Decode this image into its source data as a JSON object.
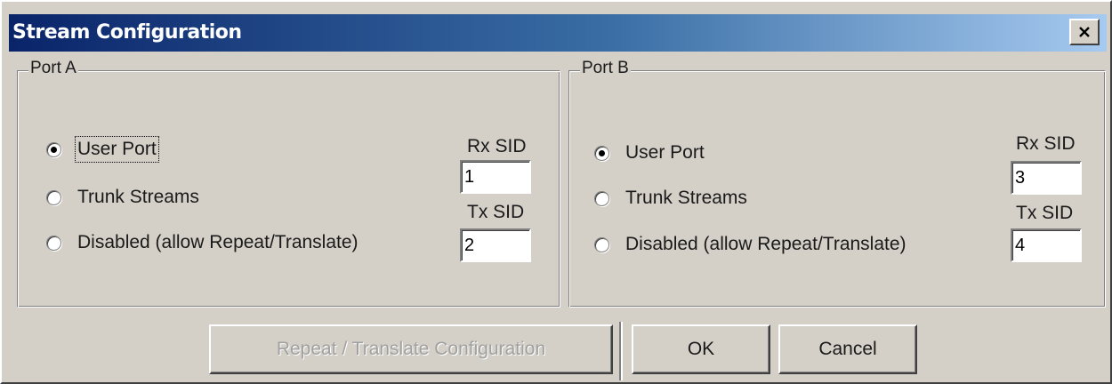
{
  "window": {
    "title": "Stream Configuration",
    "close_icon": "close-x-icon"
  },
  "port_a": {
    "legend": "Port A",
    "options": [
      {
        "label": "User Port",
        "selected": true
      },
      {
        "label": "Trunk Streams",
        "selected": false
      },
      {
        "label": "Disabled (allow Repeat/Translate)",
        "selected": false
      }
    ],
    "rx_label": "Rx SID",
    "rx_value": "1",
    "tx_label": "Tx SID",
    "tx_value": "2"
  },
  "port_b": {
    "legend": "Port B",
    "options": [
      {
        "label": "User Port",
        "selected": true
      },
      {
        "label": "Trunk Streams",
        "selected": false
      },
      {
        "label": "Disabled (allow Repeat/Translate)",
        "selected": false
      }
    ],
    "rx_label": "Rx SID",
    "rx_value": "3",
    "tx_label": "Tx SID",
    "tx_value": "4"
  },
  "buttons": {
    "repeat_translate_label": "Repeat / Translate Configuration",
    "repeat_translate_enabled": false,
    "ok_label": "OK",
    "cancel_label": "Cancel"
  }
}
